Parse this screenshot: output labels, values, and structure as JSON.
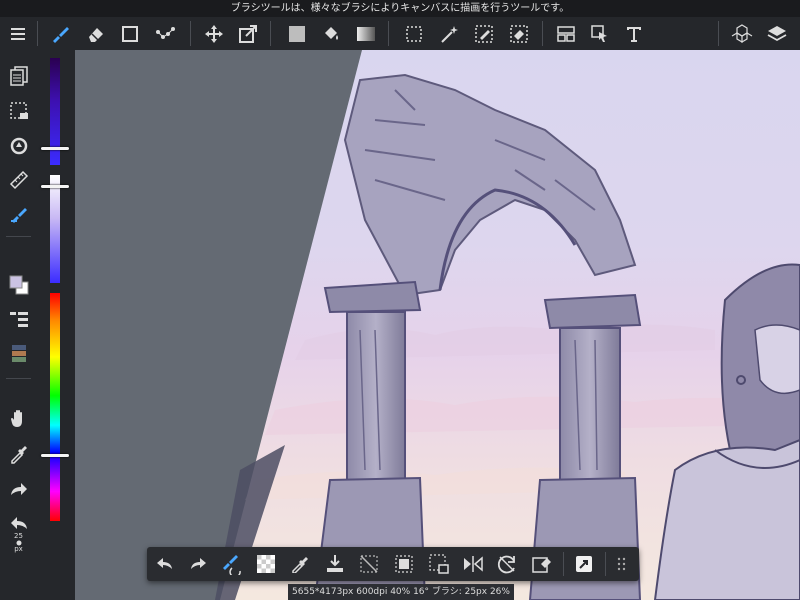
{
  "tip_text": "ブラシツールは、様々なブラシによりキャンバスに描画を行うツールです。",
  "status_text": "5655*4173px 600dpi 40% 16° ブラシ: 25px 26%",
  "zoom": {
    "value": "26",
    "unit": "%"
  },
  "brush_size_label": {
    "value": "25",
    "unit": "px"
  },
  "colors": {
    "panel_bg": "#25272b",
    "workspace_bg": "#646a73",
    "active_tool": "#4aa8ff",
    "foreground_color": "#cbc3e3"
  },
  "toolbar_icons": [
    "menu-icon",
    "brush-icon",
    "eraser-icon",
    "rectangle-icon",
    "dot-icon",
    "move-icon",
    "transform-icon",
    "fill-rect-icon",
    "bucket-icon",
    "gradient-icon",
    "select-rect-icon",
    "magic-wand-icon",
    "select-pen-icon",
    "select-eraser-icon",
    "layout-icon",
    "operation-icon",
    "text-icon",
    "3d-icon",
    "layers-icon"
  ],
  "bottom_icons": [
    "undo-icon",
    "redo-icon",
    "brush-eraser-icon",
    "transparent-icon",
    "eyedropper-icon",
    "save-icon",
    "deselect-icon",
    "select-all-icon",
    "select-clip-icon",
    "flip-icon",
    "rotate-reset-icon",
    "eraser-fill-icon",
    "shortcut-icon",
    "grid-icon"
  ]
}
